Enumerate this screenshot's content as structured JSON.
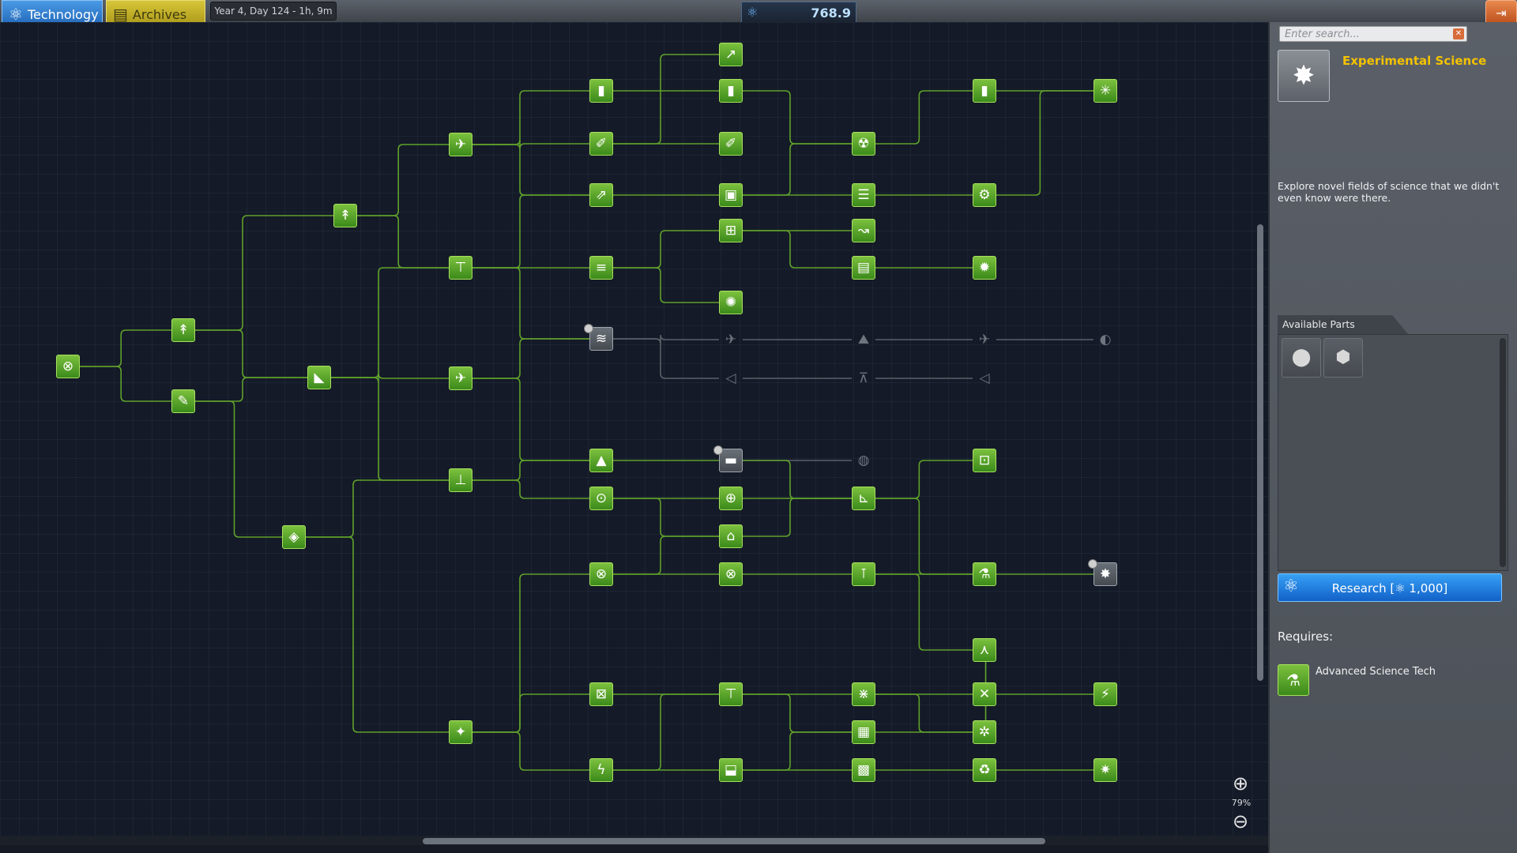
{
  "topbar": {
    "tab_technology": "Technology",
    "tab_archives": "Archives",
    "date": "Year 4, Day 124 - 1h, 9m",
    "science_points": "768.9",
    "colors": {
      "tech_tab": "#1f63b4",
      "archives_tab": "#a69317",
      "unlocked": "#4fa224",
      "locked": "#6f757e"
    }
  },
  "tree": {
    "zoom_label": "79%",
    "nodes": [
      {
        "id": "start",
        "icon": "⊗",
        "state": "green",
        "name": "start-node"
      },
      {
        "id": "basic-rocketry",
        "icon": "↟",
        "state": "green",
        "name": "basic-rocketry-node"
      },
      {
        "id": "engineering-101",
        "icon": "✎",
        "state": "green",
        "name": "engineering-101-node"
      },
      {
        "id": "general-rocketry",
        "icon": "↟",
        "state": "green",
        "name": "general-rocketry-node"
      },
      {
        "id": "stability",
        "icon": "◣",
        "state": "green",
        "name": "stability-node"
      },
      {
        "id": "survivability",
        "icon": "◈",
        "state": "green",
        "name": "survivability-node"
      },
      {
        "id": "advanced-rocketry",
        "icon": "✈",
        "state": "green",
        "name": "advanced-rocketry-node"
      },
      {
        "id": "general-construction",
        "icon": "⊤",
        "state": "green",
        "name": "general-construction-node"
      },
      {
        "id": "aviation",
        "icon": "✈",
        "state": "green",
        "name": "aviation-node"
      },
      {
        "id": "flight-control",
        "icon": "⊥",
        "state": "green",
        "name": "flight-control-node"
      },
      {
        "id": "basic-science",
        "icon": "✦",
        "state": "green",
        "name": "basic-science-node"
      },
      {
        "id": "heavy-rocketry",
        "icon": "▮",
        "state": "green",
        "name": "heavy-rocketry-node"
      },
      {
        "id": "fuel-systems",
        "icon": "✐",
        "state": "green",
        "name": "fuel-systems-node"
      },
      {
        "id": "propulsion-systems",
        "icon": "⇗",
        "state": "green",
        "name": "propulsion-systems-node"
      },
      {
        "id": "advanced-construction",
        "icon": "≡",
        "state": "green",
        "name": "advanced-construction-node"
      },
      {
        "id": "aerodynamics",
        "icon": "≋",
        "state": "selected",
        "name": "aerodynamics-node"
      },
      {
        "id": "landing",
        "icon": "▲",
        "state": "green",
        "name": "landing-node"
      },
      {
        "id": "advanced-flight-control",
        "icon": "⊙",
        "state": "green",
        "name": "advanced-flight-control-node"
      },
      {
        "id": "space-exploration",
        "icon": "⊗",
        "state": "green",
        "name": "space-exploration-node"
      },
      {
        "id": "miniaturization",
        "icon": "⊠",
        "state": "green",
        "name": "miniaturization-node"
      },
      {
        "id": "electrics",
        "icon": "ϟ",
        "state": "green",
        "name": "electrics-node"
      },
      {
        "id": "very-heavy-rocketry",
        "icon": "↗",
        "state": "green",
        "name": "very-heavy-rocketry-node"
      },
      {
        "id": "heavier-rocketry",
        "icon": "▮",
        "state": "green",
        "name": "heavier-rocketry-node"
      },
      {
        "id": "advanced-fuel-systems",
        "icon": "✐",
        "state": "green",
        "name": "advanced-fuel-systems-node"
      },
      {
        "id": "large-volume-containment",
        "icon": "▣",
        "state": "green",
        "name": "large-volume-containment-node"
      },
      {
        "id": "specialized-construction",
        "icon": "⊞",
        "state": "green",
        "name": "specialized-construction-node"
      },
      {
        "id": "composites",
        "icon": "✺",
        "state": "green",
        "name": "composites-node"
      },
      {
        "id": "subsonic-flight",
        "icon": "✈",
        "state": "grey",
        "name": "subsonic-flight-node"
      },
      {
        "id": "advanced-aerodynamics",
        "icon": "◁",
        "state": "grey",
        "name": "advanced-aerodynamics-node"
      },
      {
        "id": "advanced-landing",
        "icon": "▬",
        "state": "selected",
        "name": "advanced-landing-node"
      },
      {
        "id": "specialized-control",
        "icon": "⊕",
        "state": "green",
        "name": "specialized-control-node"
      },
      {
        "id": "precision-engineering",
        "icon": "⌂",
        "state": "green",
        "name": "precision-engineering-node"
      },
      {
        "id": "advanced-exploration",
        "icon": "⊗",
        "state": "green",
        "name": "advanced-exploration-node"
      },
      {
        "id": "precision-propulsion",
        "icon": "⊤",
        "state": "green",
        "name": "precision-propulsion-node"
      },
      {
        "id": "advanced-electrics",
        "icon": "⬓",
        "state": "green",
        "name": "advanced-electrics-node"
      },
      {
        "id": "nuclear-propulsion",
        "icon": "☢",
        "state": "green",
        "name": "nuclear-propulsion-node"
      },
      {
        "id": "high-performance-fuel",
        "icon": "☰",
        "state": "green",
        "name": "high-performance-fuel-node"
      },
      {
        "id": "advanced-motors",
        "icon": "↝",
        "state": "green",
        "name": "advanced-motors-node"
      },
      {
        "id": "metaMaterials",
        "icon": "▤",
        "state": "green",
        "name": "meta-materials-node"
      },
      {
        "id": "supersonic-flight",
        "icon": "⛰",
        "state": "grey",
        "name": "supersonic-flight-node"
      },
      {
        "id": "high-altitude-flight",
        "icon": "⊼",
        "state": "grey",
        "name": "high-altitude-flight-node"
      },
      {
        "id": "heavy-landing",
        "icon": "◍",
        "state": "grey",
        "name": "heavy-landing-node"
      },
      {
        "id": "advanced-unmanned",
        "icon": "⊾",
        "state": "green",
        "name": "advanced-unmanned-node"
      },
      {
        "id": "electronics",
        "icon": "⊺",
        "state": "green",
        "name": "electronics-node"
      },
      {
        "id": "ion-propulsion",
        "icon": "⋇",
        "state": "green",
        "name": "ion-propulsion-node"
      },
      {
        "id": "automation",
        "icon": "▦",
        "state": "green",
        "name": "automation-node"
      },
      {
        "id": "experimental-electrics",
        "icon": "▩",
        "state": "green",
        "name": "experimental-electrics-node"
      },
      {
        "id": "very-heavy-rocketry-2",
        "icon": "▮",
        "state": "green",
        "name": "heavy-rocketry-2-node"
      },
      {
        "id": "experimental-motors",
        "icon": "⚙",
        "state": "green",
        "name": "experimental-motors-node"
      },
      {
        "id": "composites-2",
        "icon": "✹",
        "state": "green",
        "name": "composites-2-node"
      },
      {
        "id": "hypersonic-flight",
        "icon": "✈",
        "state": "grey",
        "name": "hypersonic-flight-node"
      },
      {
        "id": "aerospace-tech",
        "icon": "◁",
        "state": "grey",
        "name": "aerospace-tech-node"
      },
      {
        "id": "field-science",
        "icon": "⊡",
        "state": "green",
        "name": "field-science-node"
      },
      {
        "id": "advanced-science",
        "icon": "⚗",
        "state": "green",
        "name": "advanced-science-node"
      },
      {
        "id": "unmanned-tech",
        "icon": "⋏",
        "state": "green",
        "name": "unmanned-tech-node"
      },
      {
        "id": "specialized-electrics",
        "icon": "✕",
        "state": "green",
        "name": "specialized-electrics-node"
      },
      {
        "id": "large-unmanned",
        "icon": "✲",
        "state": "green",
        "name": "large-unmanned-node"
      },
      {
        "id": "experimental-aerodynamics",
        "icon": "♻",
        "state": "green",
        "name": "experimental-aerodynamics-node"
      },
      {
        "id": "top-rocketry",
        "icon": "✳",
        "state": "green",
        "name": "top-rocketry-node"
      },
      {
        "id": "experimental-science",
        "icon": "✸",
        "state": "selected",
        "name": "experimental-science-node"
      },
      {
        "id": "top-electrics",
        "icon": "⚡",
        "state": "green",
        "name": "top-electrics-node"
      },
      {
        "id": "top-science",
        "icon": "✷",
        "state": "green",
        "name": "top-science-node"
      },
      {
        "id": "top-grey",
        "icon": "◐",
        "state": "grey",
        "name": "end-grey-node"
      }
    ]
  },
  "panel": {
    "search_placeholder": "Enter search...",
    "tech_title": "Experimental Science",
    "tech_description": "Explore novel fields of science that we didn't even know were there.",
    "available_parts_label": "Available Parts",
    "parts": [
      {
        "icon": "⬤",
        "name": "part-1"
      },
      {
        "icon": "⬢",
        "name": "part-2"
      }
    ],
    "research_label": "Research [⚛ 1,000]",
    "requires_label": "Requires:",
    "requirement_name": "Advanced Science Tech"
  }
}
